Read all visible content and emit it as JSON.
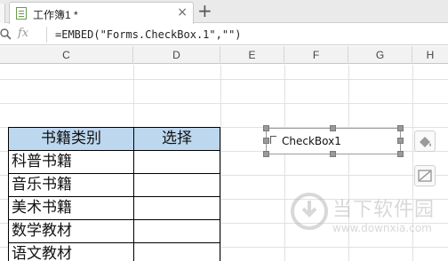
{
  "tabs": {
    "document_title": "工作簿1 *",
    "close_glyph": "×",
    "new_tab_glyph": "+"
  },
  "formula_bar": {
    "fx_label": "fx",
    "formula": "=EMBED(\"Forms.CheckBox.1\",\"\")"
  },
  "columns": [
    "C",
    "D",
    "E",
    "F",
    "G",
    "H"
  ],
  "table": {
    "headers": [
      "书籍类别",
      "选择"
    ],
    "rows": [
      [
        "科普书籍",
        ""
      ],
      [
        "音乐书籍",
        ""
      ],
      [
        "美术书籍",
        ""
      ],
      [
        "数学教材",
        ""
      ],
      [
        "语文教材",
        ""
      ]
    ]
  },
  "checkbox_control": {
    "label": "CheckBox1"
  },
  "watermark": {
    "brand": "当下软件园",
    "url": "www.downxia.com"
  },
  "colors": {
    "header_fill": "#bdd7ee",
    "tab_icon": "#6a9b4c"
  }
}
